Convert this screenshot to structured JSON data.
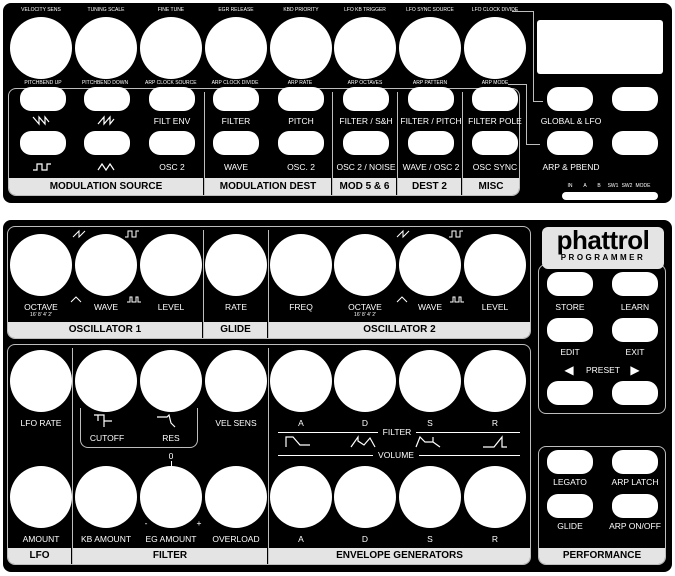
{
  "top": {
    "knob_labels": [
      "VELOCITY SENS",
      "TUNING SCALE",
      "FINE TUNE",
      "EGR RELEASE",
      "KBD PRIORITY",
      "LFO KB TRIGGER",
      "LFO SYNC SOURCE",
      "LFO CLOCK DIVIDE"
    ],
    "pill_top_labels": [
      "PITCHBEND UP",
      "PITCHBEND DOWN",
      "ARP CLOCK SOURCE",
      "ARP CLOCK DIVIDE",
      "ARP RATE",
      "ARP OCTAVES",
      "ARP PATTERN",
      "ARP MODE"
    ],
    "row1_labels": [
      "FILT ENV",
      "FILTER",
      "PITCH",
      "FILTER / S&H",
      "FILTER / PITCH",
      "FILTER POLE",
      "GLOBAL & LFO"
    ],
    "row2_labels": [
      "OSC 2",
      "WAVE",
      "OSC. 2",
      "OSC 2 / NOISE",
      "WAVE / OSC 2",
      "OSC SYNC",
      "ARP & PBEND"
    ],
    "sections": [
      "MODULATION SOURCE",
      "MODULATION DEST",
      "MOD 5 & 6",
      "DEST 2",
      "MISC"
    ],
    "indicator_labels": [
      "IN",
      "A",
      "B",
      "SW1",
      "SW2",
      "MODE"
    ]
  },
  "bottom": {
    "knob_labels": [
      "OCTAVE",
      "WAVE",
      "LEVEL",
      "RATE",
      "FREQ",
      "OCTAVE",
      "WAVE",
      "LEVEL",
      "LFO RATE",
      "VEL SENS",
      "AMOUNT",
      "KB AMOUNT",
      "EG AMOUNT",
      "OVERLOAD"
    ],
    "octave_marks": "16' 8' 4' 2'",
    "filter_knob_labels": [
      "CUTOFF",
      "RES"
    ],
    "eg_labels": [
      "A",
      "D",
      "S",
      "R"
    ],
    "eg_bottom_labels": [
      "A",
      "D",
      "S",
      "R"
    ],
    "filter_word": "FILTER",
    "volume_word": "VOLUME",
    "eg_center_mark": "0",
    "eg_minus": "-",
    "eg_plus": "+",
    "sections": [
      "OSCILLATOR 1",
      "GLIDE",
      "OSCILLATOR 2",
      "LFO",
      "FILTER",
      "ENVELOPE GENERATORS",
      "PERFORMANCE"
    ],
    "logo_main": "phattrol",
    "logo_sub": "PROGRAMMER",
    "right_buttons": [
      "STORE",
      "LEARN",
      "EDIT",
      "EXIT"
    ],
    "preset_label": "PRESET",
    "preset_left": "◀",
    "preset_right": "▶",
    "perf_buttons": [
      "LEGATO",
      "ARP LATCH",
      "GLIDE",
      "ARP ON/OFF"
    ]
  }
}
